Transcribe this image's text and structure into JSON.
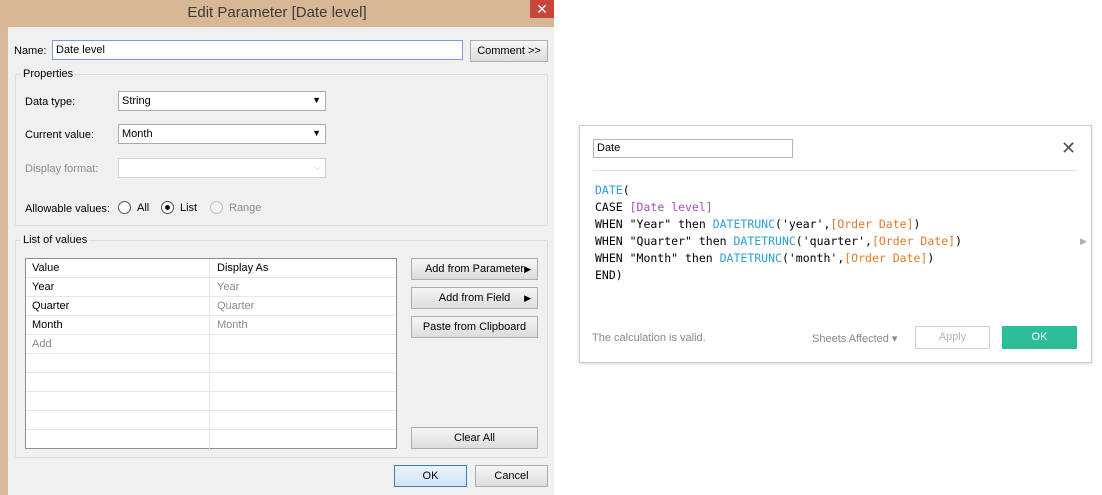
{
  "dialog": {
    "title": "Edit Parameter [Date level]",
    "close_glyph": "✕",
    "name_label": "Name:",
    "name_value": "Date level",
    "comment_button": "Comment >>",
    "properties": {
      "title": "Properties",
      "data_type_label": "Data type:",
      "data_type_value": "String",
      "current_value_label": "Current value:",
      "current_value_value": "Month",
      "display_format_label": "Display format:",
      "display_format_value": "",
      "allowable_values_label": "Allowable values:",
      "allowable_options": [
        "All",
        "List",
        "Range"
      ],
      "selected_allowable": "List"
    },
    "list_of_values": {
      "title": "List of values",
      "columns": [
        "Value",
        "Display As"
      ],
      "rows": [
        {
          "value": "Year",
          "display": "Year"
        },
        {
          "value": "Quarter",
          "display": "Quarter"
        },
        {
          "value": "Month",
          "display": "Month"
        }
      ],
      "add_placeholder": "Add",
      "buttons": {
        "add_from_parameter": "Add from Parameter",
        "add_from_field": "Add from Field",
        "paste_from_clipboard": "Paste from Clipboard",
        "clear_all": "Clear All"
      }
    },
    "ok_button": "OK",
    "cancel_button": "Cancel"
  },
  "calculation": {
    "name": "Date",
    "close_glyph": "✕",
    "code": {
      "line1_func": "DATE",
      "line1_paren": "(",
      "line2_kw": "CASE ",
      "line2_param": "[Date level]",
      "line3_pre": "WHEN \"Year\" then ",
      "line3_func": "DATETRUNC",
      "line3_arg": "('year',",
      "line3_field": "[Order Date]",
      "line3_end": ")",
      "line4_pre": "WHEN \"Quarter\" then ",
      "line4_func": "DATETRUNC",
      "line4_arg": "('quarter',",
      "line4_field": "[Order Date]",
      "line4_end": ")",
      "line5_pre": "WHEN \"Month\" then ",
      "line5_func": "DATETRUNC",
      "line5_arg": "('month',",
      "line5_field": "[Order Date]",
      "line5_end": ")",
      "line6": "END)"
    },
    "status": "The calculation is valid.",
    "sheets_affected": "Sheets Affected",
    "apply_button": "Apply",
    "ok_button": "OK",
    "colors": {
      "function": "#2a9fd6",
      "field": "#e0792c",
      "parameter": "#a24fc0",
      "ok": "#2dbd97"
    }
  }
}
